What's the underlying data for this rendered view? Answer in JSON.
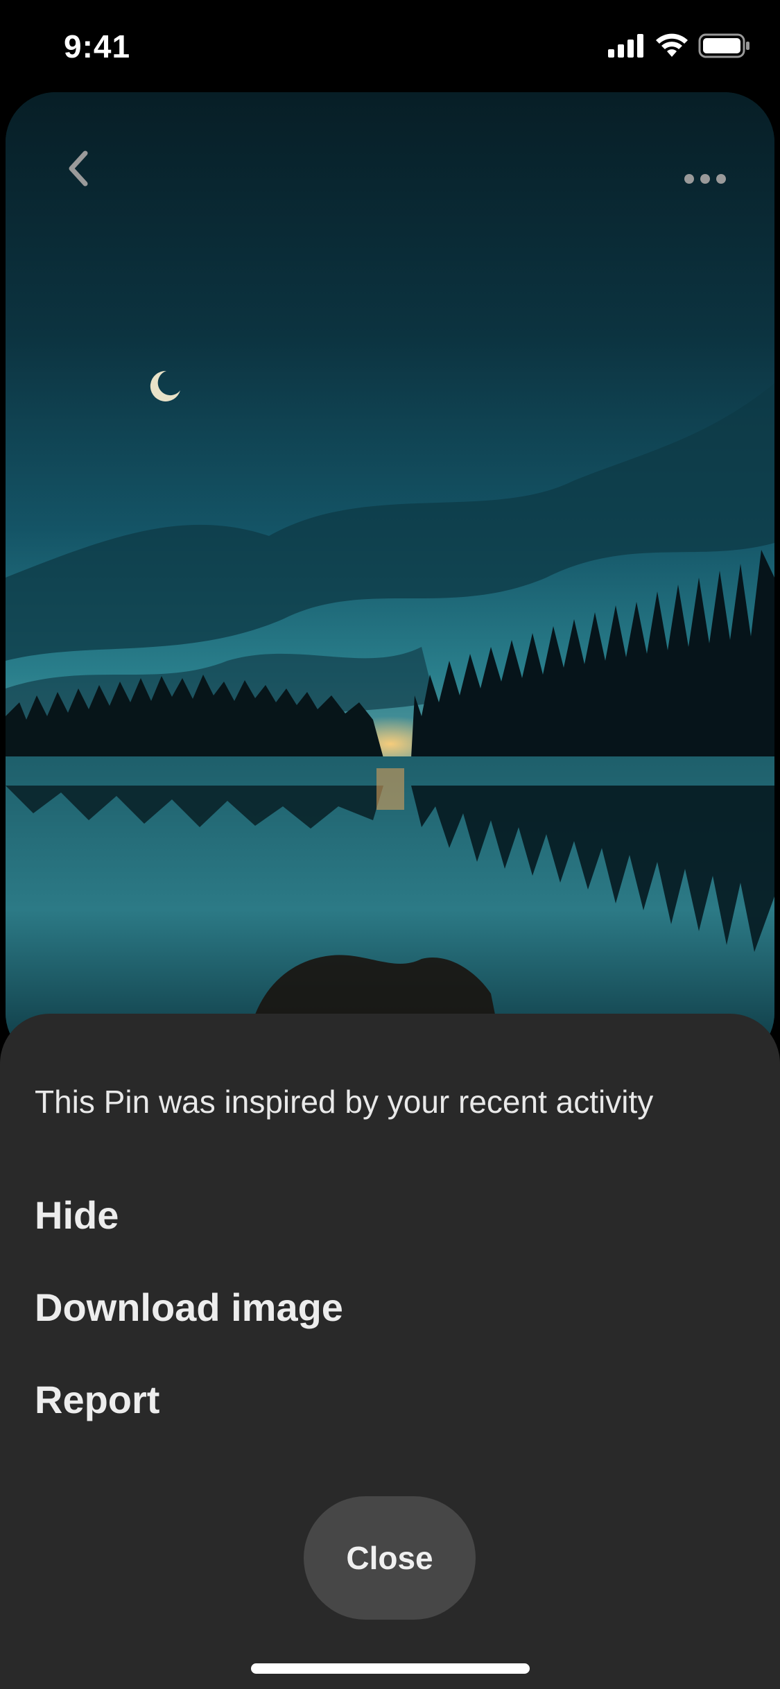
{
  "status_bar": {
    "time": "9:41",
    "icons": [
      "cellular-signal-icon",
      "wifi-icon",
      "battery-icon"
    ]
  },
  "pin": {
    "image_description_icon": "night-lake-forest-photo",
    "back_icon": "chevron-left-icon",
    "more_icon": "ellipsis-icon"
  },
  "sheet": {
    "subtitle": "This Pin was inspired by your recent activity",
    "items": [
      {
        "label": "Hide"
      },
      {
        "label": "Download image"
      },
      {
        "label": "Report"
      }
    ],
    "close_label": "Close"
  },
  "colors": {
    "sheet_background": "#292929",
    "close_button_background": "#474747",
    "text_primary": "#ededed",
    "status_bar_background": "#000000"
  }
}
